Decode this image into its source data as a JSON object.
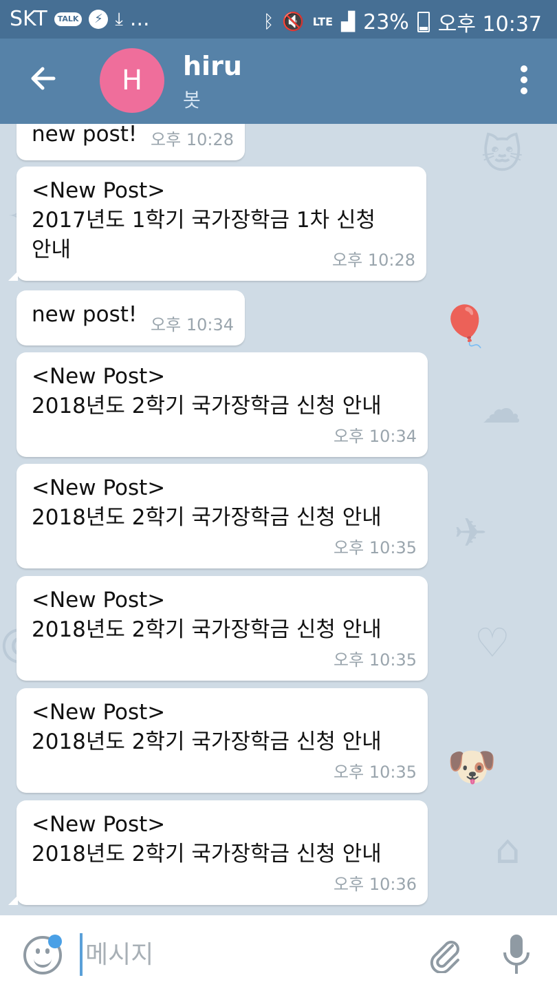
{
  "status_bar": {
    "carrier": "SKT",
    "talk_badge": "TALK",
    "more": "...",
    "network": "LTE",
    "battery": "23%",
    "time": "오후 10:37"
  },
  "header": {
    "avatar_letter": "H",
    "title": "hiru",
    "subtitle": "봇"
  },
  "messages": [
    {
      "text": "new post!",
      "time": "오후 10:28"
    },
    {
      "text": "<New Post>\n2017년도 1학기 국가장학금 1차 신청\n안내",
      "time": "오후 10:28"
    },
    {
      "text": "new post!",
      "time": "오후 10:34"
    },
    {
      "text": "<New Post>\n2018년도 2학기 국가장학금 신청 안내",
      "time": "오후 10:34"
    },
    {
      "text": "<New Post>\n2018년도 2학기 국가장학금 신청 안내",
      "time": "오후 10:35"
    },
    {
      "text": "<New Post>\n2018년도 2학기 국가장학금 신청 안내",
      "time": "오후 10:35"
    },
    {
      "text": "<New Post>\n2018년도 2학기 국가장학금 신청 안내",
      "time": "오후 10:35"
    },
    {
      "text": "<New Post>\n2018년도 2학기 국가장학금 신청 안내",
      "time": "오후 10:36"
    }
  ],
  "input": {
    "placeholder": "메시지"
  },
  "colors": {
    "status_bar": "#466f94",
    "app_bar": "#5682a8",
    "avatar": "#ef6e9b",
    "chat_background": "#cfdbe5",
    "unread_dot": "#4aa0e6"
  }
}
